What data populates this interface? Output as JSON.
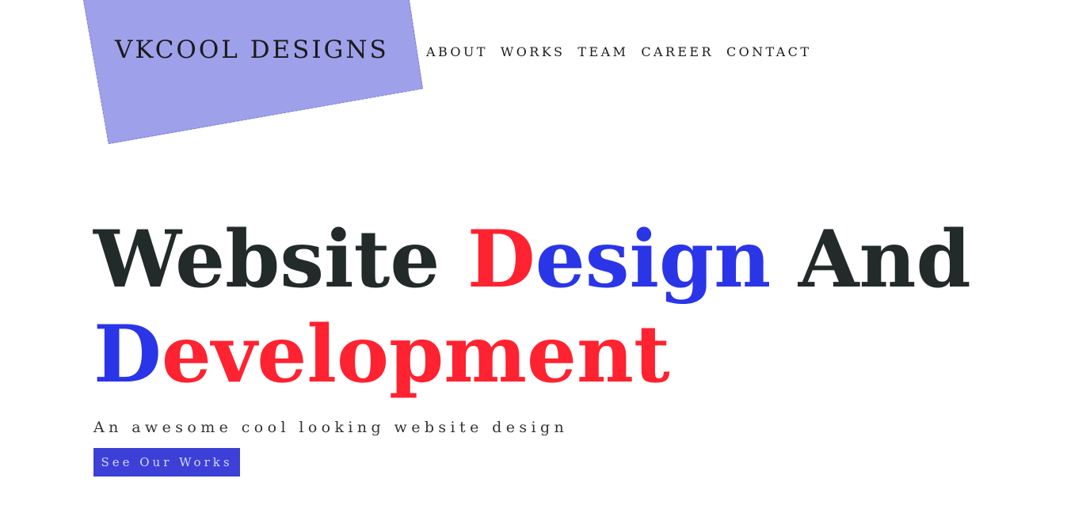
{
  "brand": {
    "name": "VKCOOL DESIGNS",
    "plate_color": "#9ea1e9"
  },
  "nav": {
    "items": [
      {
        "label": "ABOUT"
      },
      {
        "label": "WORKS"
      },
      {
        "label": "TEAM"
      },
      {
        "label": "CAREER"
      },
      {
        "label": "CONTACT"
      }
    ]
  },
  "hero": {
    "title_part1": "Website ",
    "title_part2": "D",
    "title_part3": "esign",
    "title_part4": " And",
    "title_part5": "D",
    "title_part6": "evelopment",
    "subtitle": "An awesome cool looking website design",
    "cta_label": "See Our Works"
  },
  "colors": {
    "accent_red": "#ff2230",
    "accent_blue": "#2a35e8",
    "button_bg": "#3d40d6",
    "text_dark": "#222a2a"
  }
}
